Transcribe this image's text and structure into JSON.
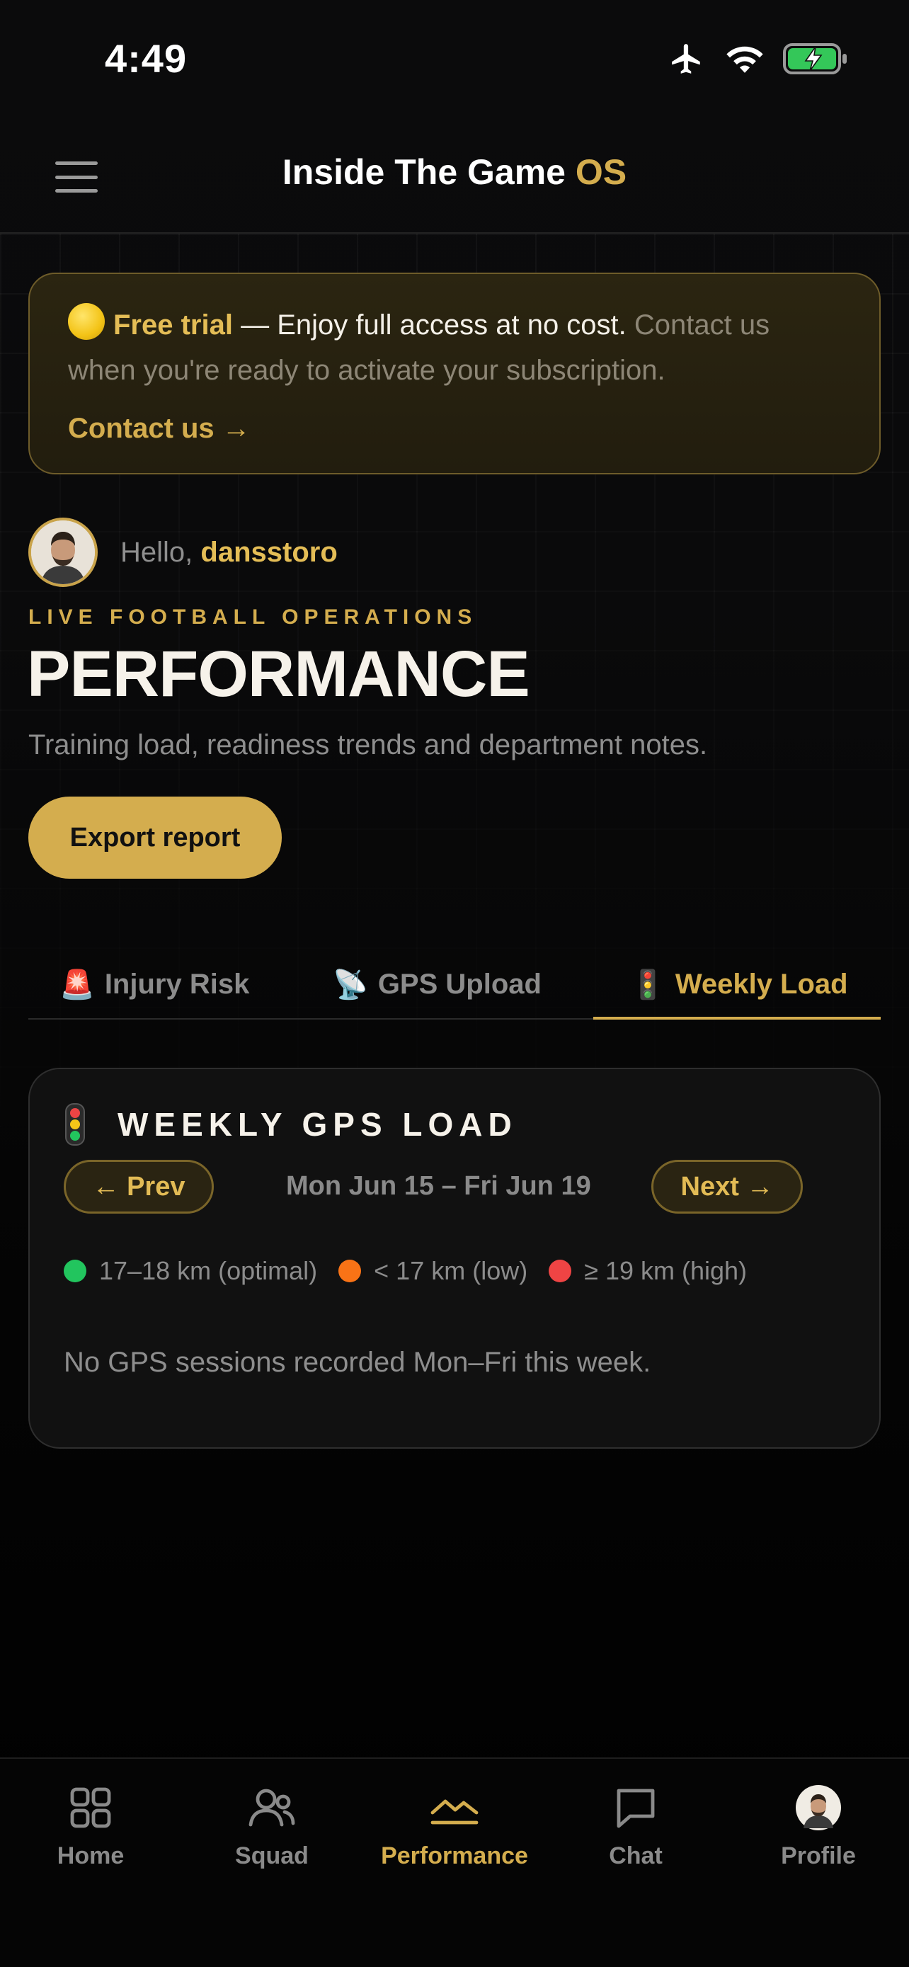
{
  "status_bar": {
    "time": "4:49"
  },
  "header": {
    "title_main": "Inside The Game",
    "title_accent": "OS"
  },
  "trial": {
    "label": "Free trial",
    "dash": " — ",
    "highlight": "Enjoy full access at no cost.",
    "rest": " Contact us when you're ready to activate your subscription.",
    "link": "Contact us →"
  },
  "greeting": {
    "prefix": "Hello, ",
    "name": "dansstoro"
  },
  "eyebrow": "LIVE FOOTBALL OPERATIONS",
  "page_title": "PERFORMANCE",
  "subtitle": "Training load, readiness trends and department notes.",
  "export_label": "Export report",
  "tabs": [
    {
      "emoji": "🚨",
      "label": "Injury Risk"
    },
    {
      "emoji": "📡",
      "label": "GPS Upload"
    },
    {
      "emoji": "🚦",
      "label": "Weekly Load",
      "active": true
    }
  ],
  "card": {
    "title": "WEEKLY GPS LOAD",
    "prev_label": "← Prev",
    "next_label": "Next →",
    "date_range": "Mon Jun 15 – Fri Jun 19",
    "legend": [
      {
        "color": "#22c55e",
        "label": "17–18 km (optimal)"
      },
      {
        "color": "#f97316",
        "label": "< 17 km (low)"
      },
      {
        "color": "#ef4444",
        "label": "≥ 19 km (high)"
      }
    ],
    "empty_message": "No GPS sessions recorded Mon–Fri this week."
  },
  "bottom_nav": [
    {
      "label": "Home",
      "icon": "grid-icon"
    },
    {
      "label": "Squad",
      "icon": "users-icon"
    },
    {
      "label": "Performance",
      "icon": "chart-line-icon",
      "active": true
    },
    {
      "label": "Chat",
      "icon": "chat-bubble-icon"
    },
    {
      "label": "Profile",
      "icon": "avatar-icon"
    }
  ],
  "colors": {
    "accent": "#d4ad4e",
    "background": "#000000"
  }
}
